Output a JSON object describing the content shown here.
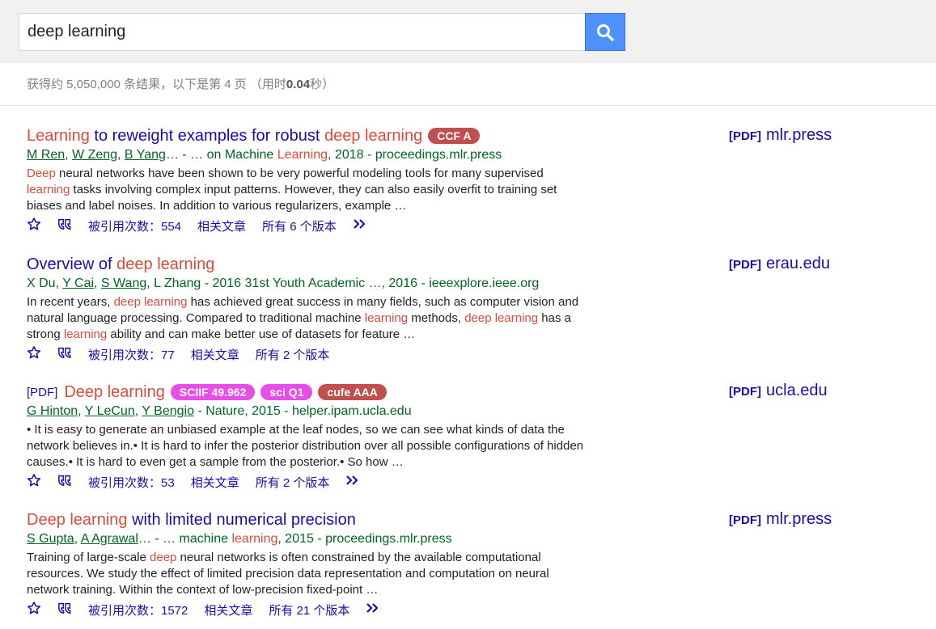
{
  "search": {
    "query": "deep learning"
  },
  "stats": {
    "prefix": "获得约 5,050,000 条结果，以下是第 4 页 （用时",
    "time": "0.04",
    "suffix": "秒）"
  },
  "colors": {
    "accent": "#4d90fe",
    "link": "#1a0dab",
    "highlight": "#dd4b39",
    "green": "#006621"
  },
  "results": [
    {
      "title": [
        {
          "text": "Learning",
          "hl": true
        },
        {
          "text": " to reweight examples for robust ",
          "hl": false
        },
        {
          "text": "deep learning",
          "hl": true
        }
      ],
      "pdf_prefix": "",
      "badges": [
        {
          "text": "CCF A",
          "color": "#c0504d"
        }
      ],
      "authors": [
        {
          "text": "M Ren",
          "u": true
        },
        {
          "text": ", ",
          "u": false
        },
        {
          "text": "W Zeng",
          "u": true
        },
        {
          "text": ", ",
          "u": false
        },
        {
          "text": "B Yang",
          "u": true
        },
        {
          "text": "… - … on Machine ",
          "u": false
        },
        {
          "text": "Learning",
          "hl": true
        },
        {
          "text": ", 2018 - proceedings.mlr.press",
          "u": false
        }
      ],
      "snippet": [
        {
          "text": "Deep",
          "hl": true
        },
        {
          "text": " neural networks have been shown to be very powerful modeling tools for many supervised ",
          "hl": false
        },
        {
          "text": "learning",
          "hl": true
        },
        {
          "text": " tasks involving complex input patterns. However, they can also easily overfit to training set biases and label noises. In addition to various regularizers, example …",
          "hl": false
        }
      ],
      "cited": "被引用次数：554",
      "related": "相关文章",
      "versions": "所有 6 个版本",
      "has_more": true,
      "side": {
        "tag": "[PDF]",
        "domain": "mlr.press"
      }
    },
    {
      "title": [
        {
          "text": "Overview of ",
          "hl": false
        },
        {
          "text": "deep learning",
          "hl": true
        }
      ],
      "pdf_prefix": "",
      "badges": [],
      "authors": [
        {
          "text": "X Du",
          "u": false
        },
        {
          "text": ", ",
          "u": false
        },
        {
          "text": "Y Cai",
          "u": true
        },
        {
          "text": ", ",
          "u": false
        },
        {
          "text": "S Wang",
          "u": true
        },
        {
          "text": ", L Zhang - 2016 31st Youth Academic …, 2016 - ieeexplore.ieee.org",
          "u": false
        }
      ],
      "snippet": [
        {
          "text": "In recent years, ",
          "hl": false
        },
        {
          "text": "deep learning",
          "hl": true
        },
        {
          "text": " has achieved great success in many fields, such as computer vision and natural language processing. Compared to traditional machine ",
          "hl": false
        },
        {
          "text": "learning",
          "hl": true
        },
        {
          "text": " methods, ",
          "hl": false
        },
        {
          "text": "deep learning",
          "hl": true
        },
        {
          "text": " has a strong ",
          "hl": false
        },
        {
          "text": "learning",
          "hl": true
        },
        {
          "text": " ability and can make better use of datasets for feature …",
          "hl": false
        }
      ],
      "cited": "被引用次数：77",
      "related": "相关文章",
      "versions": "所有 2 个版本",
      "has_more": false,
      "side": {
        "tag": "[PDF]",
        "domain": "erau.edu"
      }
    },
    {
      "title": [
        {
          "text": "Deep learning",
          "hl": true
        }
      ],
      "pdf_prefix": "[PDF]",
      "badges": [
        {
          "text": "SCIIF 49.962",
          "color": "#e84de8"
        },
        {
          "text": "sci Q1",
          "color": "#e84de8"
        },
        {
          "text": "cufe AAA",
          "color": "#c0504d"
        }
      ],
      "authors": [
        {
          "text": "G Hinton",
          "u": true
        },
        {
          "text": ", ",
          "u": false
        },
        {
          "text": "Y LeCun",
          "u": true
        },
        {
          "text": ", ",
          "u": false
        },
        {
          "text": "Y Bengio",
          "u": true
        },
        {
          "text": " - Nature, 2015 - helper.ipam.ucla.edu",
          "u": false
        }
      ],
      "snippet": [
        {
          "text": "• It is easy to generate an unbiased example at the leaf nodes, so we can see what kinds of data the network believes in.• It is hard to infer the posterior distribution over all possible configurations of hidden causes.• It is hard to even get a sample from the posterior.• So how …",
          "hl": false
        }
      ],
      "cited": "被引用次数：53",
      "related": "相关文章",
      "versions": "所有 2 个版本",
      "has_more": true,
      "side": {
        "tag": "[PDF]",
        "domain": "ucla.edu"
      }
    },
    {
      "title": [
        {
          "text": "Deep learning",
          "hl": true
        },
        {
          "text": " with limited numerical precision",
          "hl": false
        }
      ],
      "pdf_prefix": "",
      "badges": [],
      "authors": [
        {
          "text": "S Gupta",
          "u": true
        },
        {
          "text": ", ",
          "u": false
        },
        {
          "text": "A Agrawal",
          "u": true
        },
        {
          "text": "… - … machine ",
          "u": false
        },
        {
          "text": "learning",
          "hl": true
        },
        {
          "text": ", 2015 - proceedings.mlr.press",
          "u": false
        }
      ],
      "snippet": [
        {
          "text": "Training of large-scale ",
          "hl": false
        },
        {
          "text": "deep",
          "hl": true
        },
        {
          "text": " neural networks is often constrained by the available computational resources. We study the effect of limited precision data representation and computation on neural network training. Within the context of low-precision fixed-point …",
          "hl": false
        }
      ],
      "cited": "被引用次数：1572",
      "related": "相关文章",
      "versions": "所有 21 个版本",
      "has_more": true,
      "side": {
        "tag": "[PDF]",
        "domain": "mlr.press"
      }
    }
  ]
}
